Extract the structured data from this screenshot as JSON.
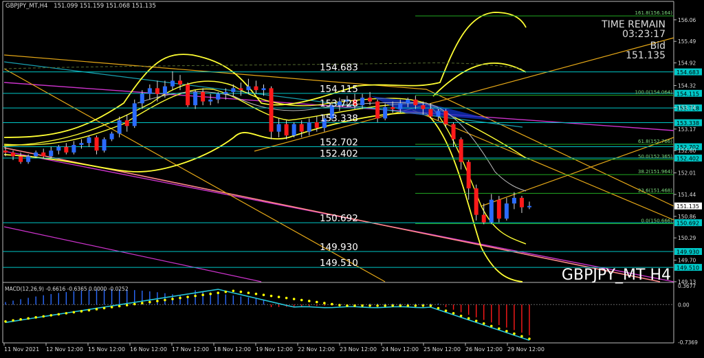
{
  "header": {
    "title": "GBPJPY_MT,H4",
    "ohlc": "151.099 151.159 151.068 151.135"
  },
  "time_remain": {
    "label": "TIME REMAIN",
    "value": "03:23:17",
    "bid_label": "Bid",
    "bid_value": "151.135"
  },
  "watermark": "GBPJPY_MT H4",
  "macd_label": "MACD(12,26,9) -0.6616 -0.6365 0.0000 -0.0252",
  "colors": {
    "background": "#000000",
    "bull_candle": "#2b6bff",
    "bear_candle": "#ff1a1a",
    "level_line": "#00c8c8",
    "fib_line": "#22aa22",
    "bollinger": "#ffff33",
    "trend_orange": "#e6a817",
    "trend_magenta": "#cc33cc",
    "macd_signal": "#ffff00",
    "macd_main": "#26c6da",
    "price_tag_bg": "#00c8c8"
  },
  "chart_data": {
    "type": "candlestick",
    "ylim": [
      149.13,
      156.33
    ],
    "price_axis_ticks": [
      156.06,
      155.49,
      154.92,
      154.32,
      153.74,
      153.17,
      152.6,
      152.01,
      151.44,
      150.86,
      150.29,
      149.7,
      149.13
    ],
    "x_ticks": [
      "11 Nov 2021",
      "12 Nov 12:00",
      "15 Nov 12:00",
      "16 Nov 12:00",
      "17 Nov 12:00",
      "18 Nov 12:00",
      "19 Nov 12:00",
      "22 Nov 12:00",
      "23 Nov 12:00",
      "24 Nov 12:00",
      "25 Nov 12:00",
      "26 Nov 12:00",
      "29 Nov 12:00"
    ],
    "levels": [
      {
        "label": "154.683",
        "value": 154.683,
        "tag": "154.683"
      },
      {
        "label": "154.115",
        "value": 154.115,
        "tag": "154.115"
      },
      {
        "label": "153.728",
        "value": 153.728,
        "tag": "153.728"
      },
      {
        "label": "153.338",
        "value": 153.338,
        "tag": "153.338"
      },
      {
        "label": "152.702",
        "value": 152.702,
        "tag": "152.702"
      },
      {
        "label": "152.402",
        "value": 152.402,
        "tag": "152.402"
      },
      {
        "label": "150.692",
        "value": 150.692,
        "tag": "150.692"
      },
      {
        "label": "149.930",
        "value": 149.93,
        "tag": "149.930"
      },
      {
        "label": "149.510",
        "value": 149.51,
        "tag": "149.510"
      }
    ],
    "fib_levels": [
      {
        "label": "161.8(156.164)",
        "value": 156.164
      },
      {
        "label": "100.0(154.064)",
        "value": 154.064
      },
      {
        "label": "61.8(152.766)",
        "value": 152.766
      },
      {
        "label": "50.0(152.365)",
        "value": 152.365
      },
      {
        "label": "38.2(151.964)",
        "value": 151.964
      },
      {
        "label": "23.6(151.468)",
        "value": 151.468
      },
      {
        "label": "0.0(150.666)",
        "value": 150.666
      }
    ],
    "current_price": {
      "value": 151.135,
      "tag": "151.135"
    },
    "candles": [
      [
        152.6,
        152.55,
        152.7,
        152.45
      ],
      [
        152.55,
        152.45,
        152.6,
        152.35
      ],
      [
        152.45,
        152.3,
        152.55,
        152.25
      ],
      [
        152.3,
        152.45,
        152.5,
        152.25
      ],
      [
        152.45,
        152.55,
        152.6,
        152.4
      ],
      [
        152.55,
        152.45,
        152.65,
        152.4
      ],
      [
        152.45,
        152.6,
        152.7,
        152.4
      ],
      [
        152.6,
        152.7,
        152.75,
        152.5
      ],
      [
        152.7,
        152.55,
        152.8,
        152.5
      ],
      [
        152.55,
        152.75,
        152.85,
        152.5
      ],
      [
        152.75,
        152.8,
        152.9,
        152.65
      ],
      [
        152.8,
        152.95,
        153.0,
        152.7
      ],
      [
        152.95,
        152.6,
        153.0,
        152.5
      ],
      [
        152.6,
        152.9,
        152.95,
        152.55
      ],
      [
        152.9,
        153.05,
        153.1,
        152.85
      ],
      [
        153.05,
        153.4,
        153.5,
        152.95
      ],
      [
        153.4,
        153.25,
        153.55,
        153.1
      ],
      [
        153.25,
        153.85,
        153.95,
        153.2
      ],
      [
        153.85,
        154.1,
        154.2,
        153.7
      ],
      [
        154.1,
        154.25,
        154.35,
        153.95
      ],
      [
        154.25,
        154.1,
        154.45,
        153.9
      ],
      [
        154.1,
        154.3,
        154.45,
        154.0
      ],
      [
        154.3,
        154.45,
        154.7,
        154.2
      ],
      [
        154.45,
        154.35,
        154.6,
        154.2
      ],
      [
        154.35,
        153.8,
        154.4,
        153.75
      ],
      [
        153.8,
        154.15,
        154.2,
        153.7
      ],
      [
        154.15,
        153.9,
        154.25,
        153.8
      ],
      [
        153.9,
        153.95,
        154.1,
        153.8
      ],
      [
        153.95,
        154.1,
        154.15,
        153.85
      ],
      [
        154.1,
        154.15,
        154.25,
        153.95
      ],
      [
        154.15,
        154.25,
        154.35,
        154.05
      ],
      [
        154.25,
        154.2,
        154.4,
        154.05
      ],
      [
        154.2,
        154.3,
        154.5,
        154.1
      ],
      [
        154.3,
        154.2,
        154.45,
        154.1
      ],
      [
        154.2,
        154.25,
        154.35,
        154.05
      ],
      [
        154.25,
        153.1,
        154.3,
        152.9
      ],
      [
        153.1,
        153.3,
        153.45,
        152.95
      ],
      [
        153.3,
        153.0,
        153.4,
        152.9
      ],
      [
        153.0,
        153.3,
        153.35,
        152.95
      ],
      [
        153.3,
        153.1,
        153.4,
        152.95
      ],
      [
        153.1,
        153.35,
        153.45,
        153.0
      ],
      [
        153.35,
        153.2,
        153.5,
        153.1
      ],
      [
        153.2,
        153.45,
        153.55,
        153.1
      ],
      [
        153.45,
        153.8,
        153.9,
        153.4
      ],
      [
        153.8,
        153.9,
        154.0,
        153.65
      ],
      [
        153.9,
        153.95,
        154.05,
        153.75
      ],
      [
        153.95,
        153.8,
        154.1,
        153.7
      ],
      [
        153.8,
        154.0,
        154.1,
        153.7
      ],
      [
        154.0,
        153.9,
        154.15,
        153.8
      ],
      [
        153.9,
        153.45,
        153.95,
        153.35
      ],
      [
        153.45,
        153.75,
        153.85,
        153.4
      ],
      [
        153.75,
        153.7,
        153.9,
        153.6
      ],
      [
        153.7,
        153.85,
        153.95,
        153.6
      ],
      [
        153.85,
        153.95,
        154.0,
        153.75
      ],
      [
        153.95,
        153.8,
        154.05,
        153.7
      ],
      [
        153.8,
        153.7,
        153.9,
        153.55
      ],
      [
        153.7,
        153.5,
        153.85,
        153.45
      ],
      [
        153.5,
        153.65,
        153.7,
        153.4
      ],
      [
        153.65,
        153.3,
        153.7,
        153.2
      ],
      [
        153.3,
        152.9,
        153.35,
        152.7
      ],
      [
        152.9,
        152.3,
        152.95,
        152.1
      ],
      [
        152.3,
        151.6,
        152.35,
        151.3
      ],
      [
        151.6,
        150.9,
        151.7,
        150.75
      ],
      [
        150.9,
        150.7,
        151.2,
        150.65
      ],
      [
        150.7,
        151.3,
        151.45,
        150.65
      ],
      [
        151.3,
        150.8,
        151.4,
        150.7
      ],
      [
        150.8,
        151.2,
        151.35,
        150.75
      ],
      [
        151.2,
        151.35,
        151.5,
        151.05
      ],
      [
        151.35,
        151.1,
        151.4,
        150.95
      ],
      [
        151.1,
        151.135,
        151.25,
        151.05
      ]
    ],
    "macd": {
      "label": "MACD(12,26,9)",
      "values": [
        -0.6616,
        -0.6365,
        0.0,
        -0.0252
      ],
      "ylim": [
        -0.7369,
        0.3677
      ],
      "axis_ticks": [
        0.3677,
        0.0,
        -0.7369
      ]
    }
  }
}
